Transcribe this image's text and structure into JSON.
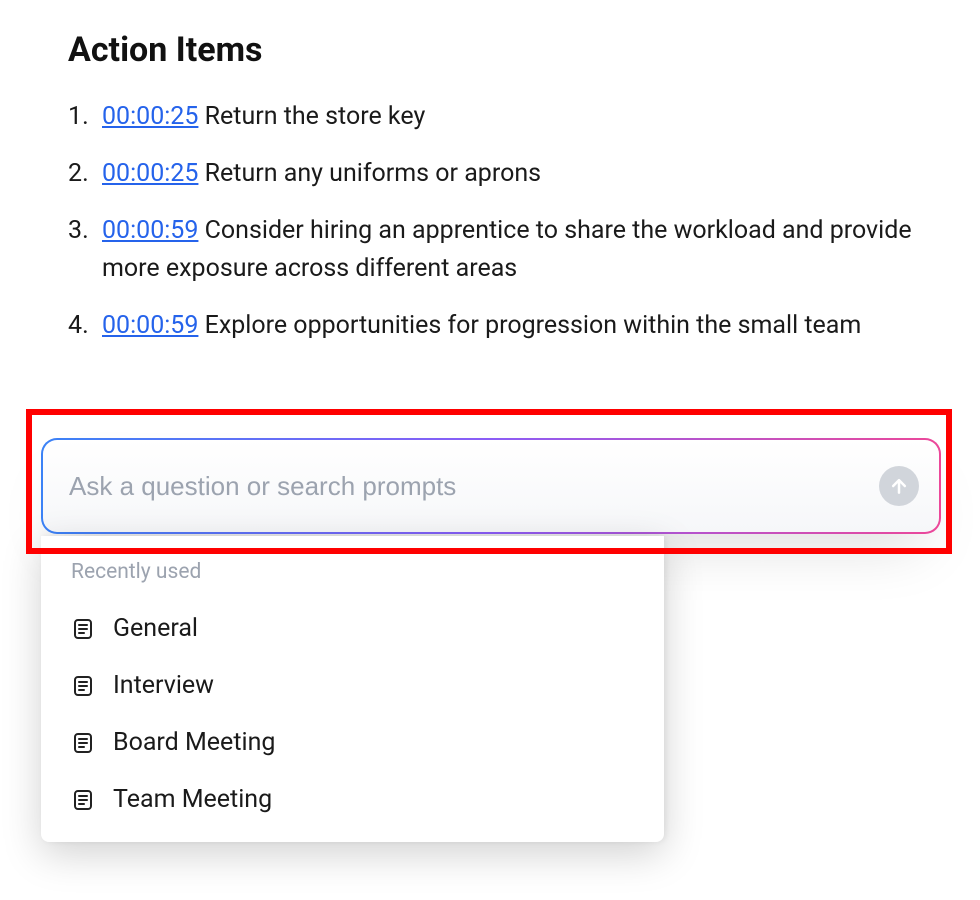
{
  "section": {
    "title": "Action Items"
  },
  "action_items": [
    {
      "timestamp": "00:00:25",
      "text": "Return the store key"
    },
    {
      "timestamp": "00:00:25",
      "text": "Return any uniforms or aprons"
    },
    {
      "timestamp": "00:00:59",
      "text": "Consider hiring an apprentice to share the workload and provide more exposure across different areas"
    },
    {
      "timestamp": "00:00:59",
      "text": "Explore opportunities for progression within the small team"
    }
  ],
  "search": {
    "placeholder": "Ask a question or search prompts",
    "value": ""
  },
  "dropdown": {
    "header": "Recently used",
    "items": [
      {
        "label": "General"
      },
      {
        "label": "Interview"
      },
      {
        "label": "Board Meeting"
      },
      {
        "label": "Team Meeting"
      }
    ]
  }
}
